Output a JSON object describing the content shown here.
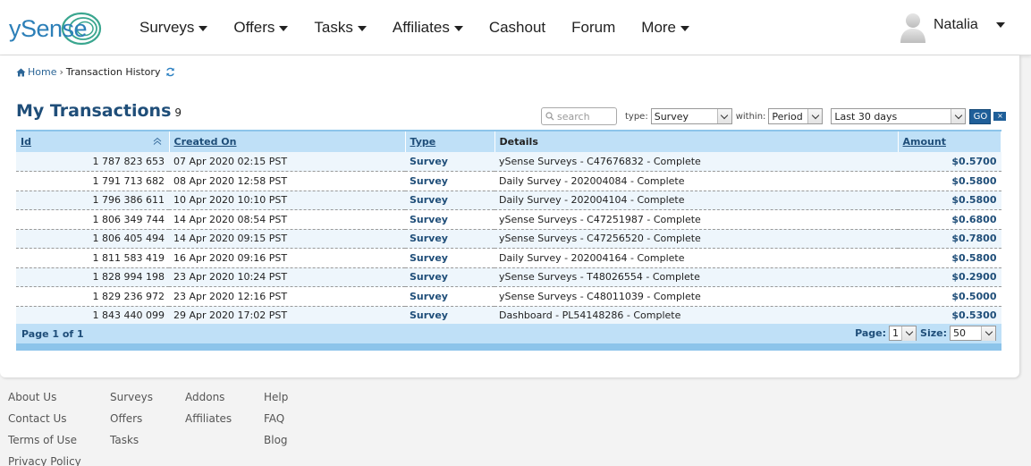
{
  "logo": {
    "text": "ySense"
  },
  "nav": [
    {
      "label": "Surveys",
      "dropdown": true
    },
    {
      "label": "Offers",
      "dropdown": true
    },
    {
      "label": "Tasks",
      "dropdown": true
    },
    {
      "label": "Affiliates",
      "dropdown": true
    },
    {
      "label": "Cashout",
      "dropdown": false
    },
    {
      "label": "Forum",
      "dropdown": false
    },
    {
      "label": "More",
      "dropdown": true
    }
  ],
  "user": {
    "name": "Natalia"
  },
  "breadcrumb": {
    "home": "Home",
    "separator": "›",
    "current": "Transaction History"
  },
  "page": {
    "title": "My Transactions",
    "count": "9"
  },
  "filters": {
    "search_placeholder": "search",
    "type_label": "type:",
    "type_value": "Survey",
    "within_label": "within:",
    "within_value": "Period",
    "range_value": "Last 30 days",
    "go_label": "GO",
    "clear_label": "×"
  },
  "table": {
    "headers": {
      "id": "Id",
      "created": "Created On",
      "type": "Type",
      "details": "Details",
      "amount": "Amount"
    },
    "rows": [
      {
        "id": "1 787 823 653",
        "created": "07 Apr 2020 02:15 PST",
        "type": "Survey",
        "details": "ySense Surveys - C47676832 - Complete",
        "amount": "$0.5700"
      },
      {
        "id": "1 791 713 682",
        "created": "08 Apr 2020 12:58 PST",
        "type": "Survey",
        "details": "Daily Survey - 202004084 - Complete",
        "amount": "$0.5800"
      },
      {
        "id": "1 796 386 611",
        "created": "10 Apr 2020 10:10 PST",
        "type": "Survey",
        "details": "Daily Survey - 202004104 - Complete",
        "amount": "$0.5800"
      },
      {
        "id": "1 806 349 744",
        "created": "14 Apr 2020 08:54 PST",
        "type": "Survey",
        "details": "ySense Surveys - C47251987 - Complete",
        "amount": "$0.6800"
      },
      {
        "id": "1 806 405 494",
        "created": "14 Apr 2020 09:15 PST",
        "type": "Survey",
        "details": "ySense Surveys - C47256520 - Complete",
        "amount": "$0.7800"
      },
      {
        "id": "1 811 583 419",
        "created": "16 Apr 2020 09:16 PST",
        "type": "Survey",
        "details": "Daily Survey - 202004164 - Complete",
        "amount": "$0.5800"
      },
      {
        "id": "1 828 994 198",
        "created": "23 Apr 2020 10:24 PST",
        "type": "Survey",
        "details": "ySense Surveys - T48026554 - Complete",
        "amount": "$0.2900"
      },
      {
        "id": "1 829 236 972",
        "created": "23 Apr 2020 12:16 PST",
        "type": "Survey",
        "details": "ySense Surveys - C48011039 - Complete",
        "amount": "$0.5000"
      },
      {
        "id": "1 843 440 099",
        "created": "29 Apr 2020 17:02 PST",
        "type": "Survey",
        "details": "Dashboard - PL54148286 - Complete",
        "amount": "$0.5300"
      }
    ]
  },
  "pager": {
    "info": "Page 1 of 1",
    "page_label": "Page:",
    "page_value": "1",
    "size_label": "Size:",
    "size_value": "50"
  },
  "footer": {
    "col1": [
      "About Us",
      "Contact Us",
      "Terms of Use",
      "Privacy Policy"
    ],
    "col2": [
      "Surveys",
      "Offers",
      "Tasks"
    ],
    "col3": [
      "Addons",
      "Affiliates"
    ],
    "col4": [
      "Help",
      "FAQ",
      "Blog"
    ]
  },
  "colors": {
    "brand": "#2c7fb8",
    "title": "#1f4e79",
    "header_bg": "#bfe0f7",
    "go_button": "#1f5f99"
  }
}
